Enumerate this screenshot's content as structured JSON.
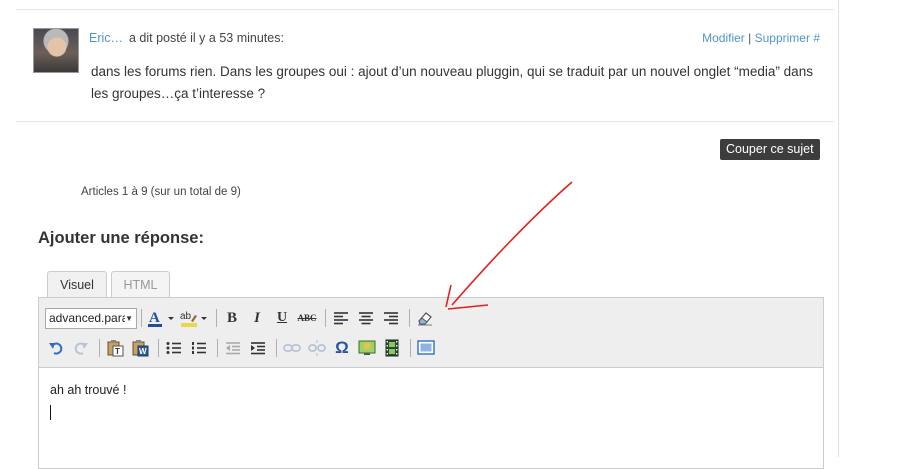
{
  "post": {
    "author": "Eric…",
    "meta": "a dit posté il y a 53 minutes:",
    "edit_link": "Modifier",
    "separator": "|",
    "delete_link": "Supprimer",
    "permalink": "#",
    "body": "dans les forums rien. Dans les groupes oui : ajout d’un nouveau pluggin, qui se traduit par un nouvel onglet “media” dans les groupes…ça t’interesse ?"
  },
  "topic": {
    "split_button": "Couper ce sujet",
    "pagination": "Articles 1 à 9 (sur un total de 9)"
  },
  "reply": {
    "title": "Ajouter une réponse:",
    "tabs": [
      {
        "label": "Visuel",
        "active": true
      },
      {
        "label": "HTML",
        "active": false
      }
    ],
    "format_select_value": "advanced.paragraph",
    "content_text": "ah ah trouvé !"
  },
  "toolbar": {
    "row1_icons": [
      "text-color-icon",
      "highlight-color-icon",
      "bold-icon",
      "italic-icon",
      "underline-icon",
      "strikethrough-icon",
      "align-left-icon",
      "align-center-icon",
      "align-right-icon",
      "eraser-icon"
    ],
    "row2_icons": [
      "undo-icon",
      "redo-icon",
      "paste-text-icon",
      "paste-word-icon",
      "bullet-list-icon",
      "numbered-list-icon",
      "outdent-icon",
      "indent-icon",
      "link-icon",
      "unlink-icon",
      "omega-icon",
      "image-icon",
      "media-icon",
      "fullscreen-icon"
    ],
    "bold_glyph": "B",
    "italic_glyph": "I",
    "underline_glyph": "U",
    "strike_glyph": "ABC",
    "omega_glyph": "Ω",
    "text_color_glyph": "A",
    "highlight_glyph": "ab"
  },
  "colors": {
    "link": "#4f96c8",
    "annotation_arrow": "#e32020",
    "dark_button": "#3d3d3d"
  }
}
